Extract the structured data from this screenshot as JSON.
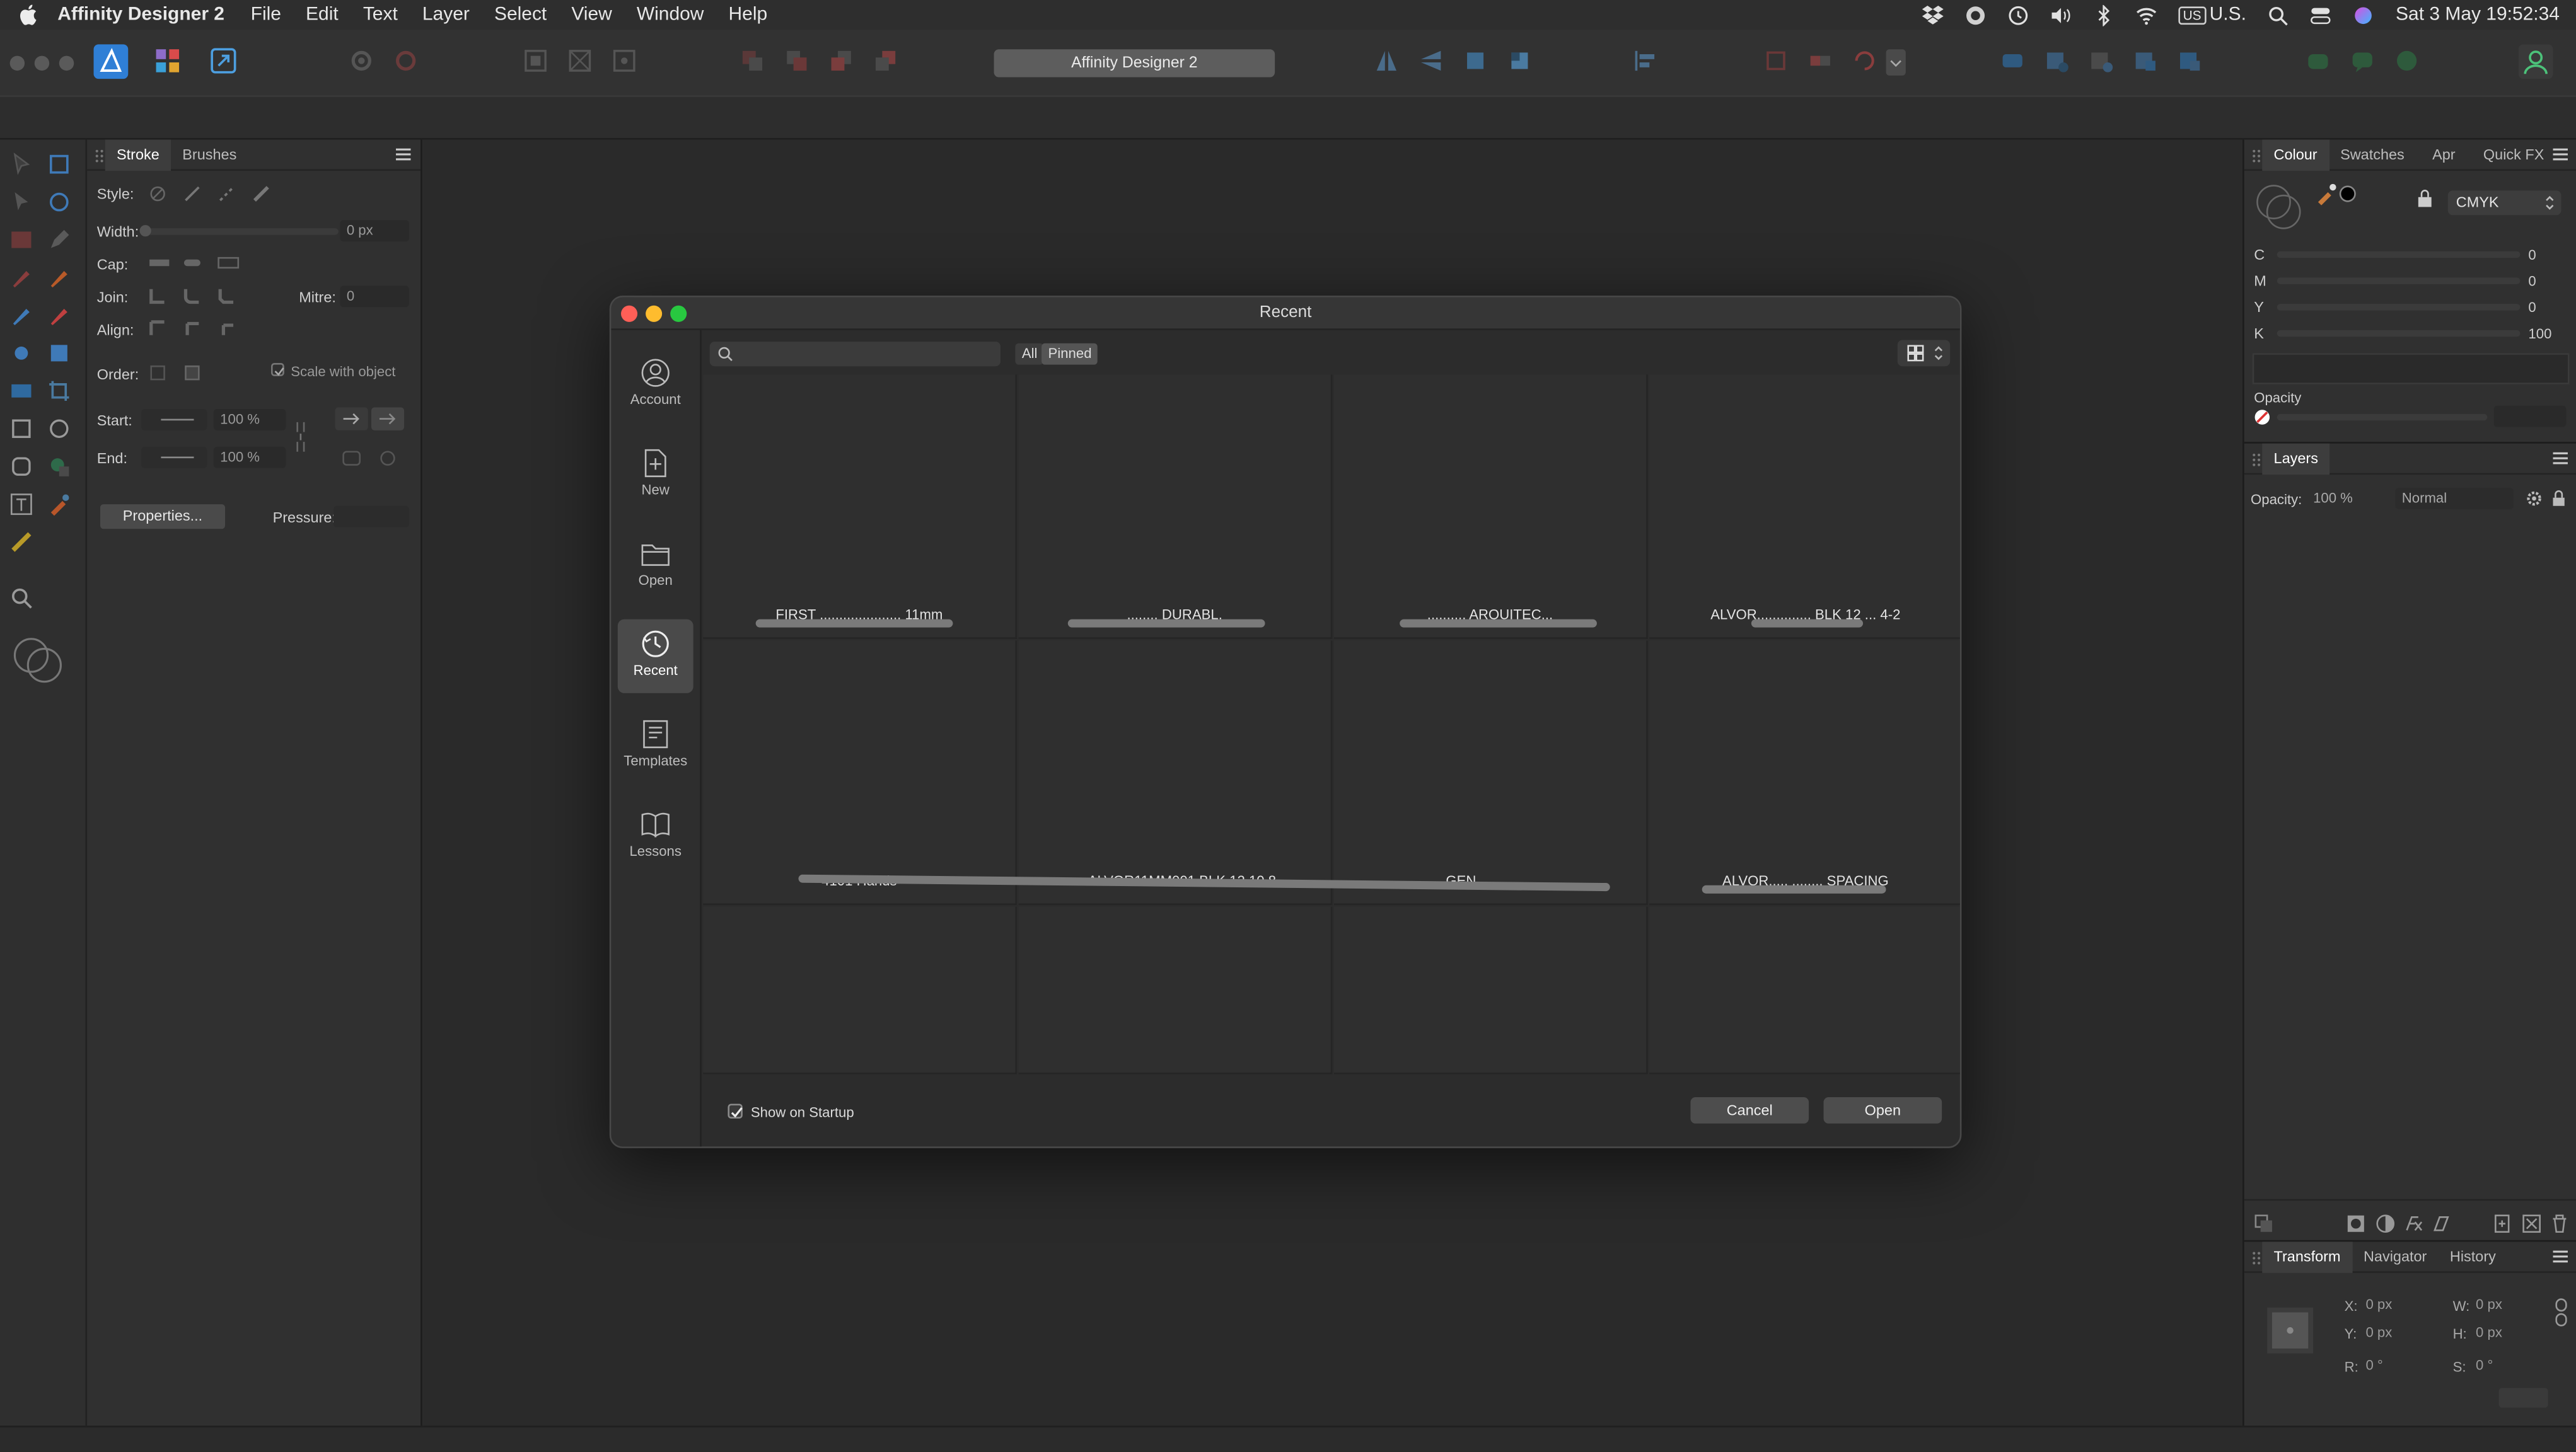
{
  "menubar": {
    "app_name": "Affinity Designer 2",
    "items": [
      "File",
      "Edit",
      "Text",
      "Layer",
      "Select",
      "View",
      "Window",
      "Help"
    ],
    "input_source_badge": "US",
    "input_source_label": "U.S.",
    "clock": "Sat 3 May  19:52:34"
  },
  "toolbar": {
    "document_title": "Affinity Designer 2"
  },
  "stroke_panel": {
    "tabs": [
      "Stroke",
      "Brushes"
    ],
    "style_label": "Style:",
    "width_label": "Width:",
    "width_value": "0 px",
    "cap_label": "Cap:",
    "join_label": "Join:",
    "mitre_label": "Mitre:",
    "mitre_value": "0",
    "align_label": "Align:",
    "order_label": "Order:",
    "scale_label": "Scale with object",
    "start_label": "Start:",
    "start_percent": "100 %",
    "end_label": "End:",
    "end_percent": "100 %",
    "properties_button": "Properties...",
    "pressure_label": "Pressure:"
  },
  "colour_panel": {
    "tabs": [
      "Colour",
      "Swatches",
      "Apr",
      "Quick FX"
    ],
    "model": "CMYK",
    "channels": [
      {
        "name": "C",
        "value": "0"
      },
      {
        "name": "M",
        "value": "0"
      },
      {
        "name": "Y",
        "value": "0"
      },
      {
        "name": "K",
        "value": "100"
      }
    ],
    "opacity_label": "Opacity"
  },
  "layers_panel": {
    "tab": "Layers",
    "opacity_label": "Opacity:",
    "opacity_value": "100 %",
    "blend_mode": "Normal"
  },
  "transform_panel": {
    "tabs": [
      "Transform",
      "Navigator",
      "History"
    ],
    "x_label": "X:",
    "x_value": "0 px",
    "y_label": "Y:",
    "y_value": "0 px",
    "w_label": "W:",
    "w_value": "0 px",
    "h_label": "H:",
    "h_value": "0 px",
    "r_label": "R:",
    "r_value": "0 °",
    "s_label": "S:",
    "s_value": "0 °"
  },
  "dialog": {
    "title": "Recent",
    "sidebar": [
      {
        "label": "Account",
        "icon": "account-icon"
      },
      {
        "label": "New",
        "icon": "new-document-icon"
      },
      {
        "label": "Open",
        "icon": "folder-icon"
      },
      {
        "label": "Recent",
        "icon": "clock-icon",
        "active": true
      },
      {
        "label": "Templates",
        "icon": "templates-icon"
      },
      {
        "label": "Lessons",
        "icon": "book-icon"
      }
    ],
    "search_placeholder": "",
    "filters": [
      "All",
      "Pinned"
    ],
    "active_filter": "All",
    "files": [
      "FIRST ..................... 11mm",
      "........ DURABL.",
      ".......... ARQUITEC...",
      "ALVOR.............. BLK 12 ... 4-2",
      "4101 Hands",
      "... ALVOR11MM001 BLK 12 10 8",
      "GEN...............",
      "ALVOR..... ........ SPACING",
      "",
      "",
      "",
      ""
    ],
    "show_on_startup_label": "Show on Startup",
    "show_on_startup_checked": true,
    "cancel_label": "Cancel",
    "open_label": "Open"
  }
}
